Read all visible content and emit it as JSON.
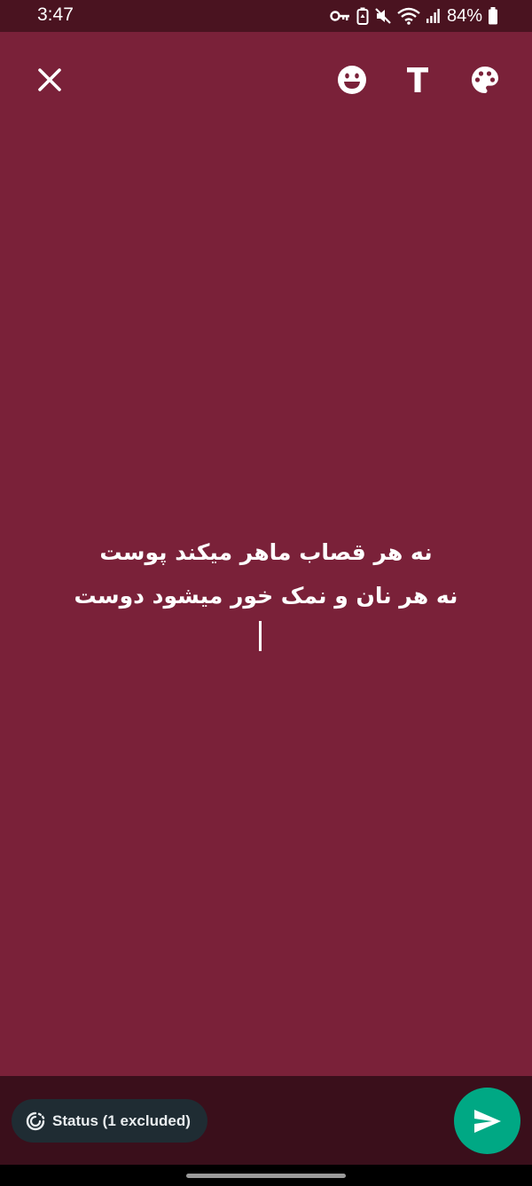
{
  "status_bar": {
    "time": "3:47",
    "battery_percent": "84%",
    "icons": [
      "vpn-key-icon",
      "battery-saver-icon",
      "mute-icon",
      "wifi-icon",
      "signal-icon",
      "battery-icon"
    ]
  },
  "toolbar": {
    "close_icon": "close-icon",
    "emoji_icon": "emoji-icon",
    "text_icon": "text-style-icon",
    "text_glyph": "T",
    "palette_icon": "palette-icon"
  },
  "composer": {
    "lines": [
      "نه هر قصاب ماهر میکند پوست",
      "نه هر نان و نمک خور میشود دوست"
    ],
    "background_color": "#7a2139",
    "text_color": "#ffffff"
  },
  "footer": {
    "audience_label": "Status (1 excluded)",
    "audience_icon": "status-ring-icon",
    "send_icon": "send-icon",
    "send_color": "#00a884"
  }
}
